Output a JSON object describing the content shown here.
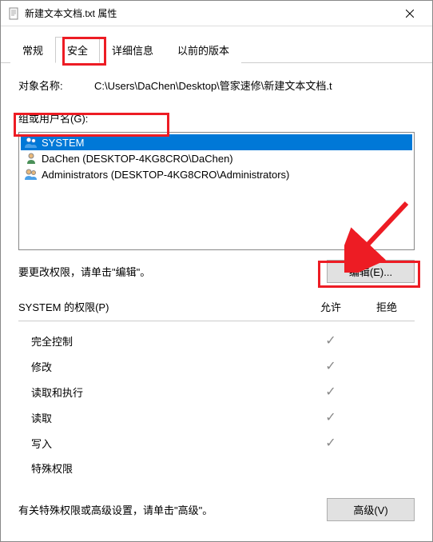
{
  "window": {
    "title": "新建文本文档.txt 属性"
  },
  "tabs": {
    "items": [
      {
        "label": "常规",
        "active": false
      },
      {
        "label": "安全",
        "active": true
      },
      {
        "label": "详细信息",
        "active": false
      },
      {
        "label": "以前的版本",
        "active": false
      }
    ]
  },
  "object": {
    "label": "对象名称:",
    "value": "C:\\Users\\DaChen\\Desktop\\管家速修\\新建文本文档.t"
  },
  "groupLabel": "组或用户名(G):",
  "users": [
    {
      "name": "SYSTEM",
      "icon": "group",
      "selected": true
    },
    {
      "name": "DaChen (DESKTOP-4KG8CRO\\DaChen)",
      "icon": "user",
      "selected": false
    },
    {
      "name": "Administrators (DESKTOP-4KG8CRO\\Administrators)",
      "icon": "group",
      "selected": false
    }
  ],
  "editRow": {
    "text": "要更改权限，请单击\"编辑\"。",
    "button": "编辑(E)..."
  },
  "permissions": {
    "headerName": "SYSTEM 的权限(P)",
    "allowCol": "允许",
    "denyCol": "拒绝",
    "rows": [
      {
        "name": "完全控制",
        "allow": true,
        "deny": false
      },
      {
        "name": "修改",
        "allow": true,
        "deny": false
      },
      {
        "name": "读取和执行",
        "allow": true,
        "deny": false
      },
      {
        "name": "读取",
        "allow": true,
        "deny": false
      },
      {
        "name": "写入",
        "allow": true,
        "deny": false
      },
      {
        "name": "特殊权限",
        "allow": false,
        "deny": false
      }
    ]
  },
  "advanced": {
    "text": "有关特殊权限或高级设置，请单击\"高级\"。",
    "button": "高级(V)"
  }
}
